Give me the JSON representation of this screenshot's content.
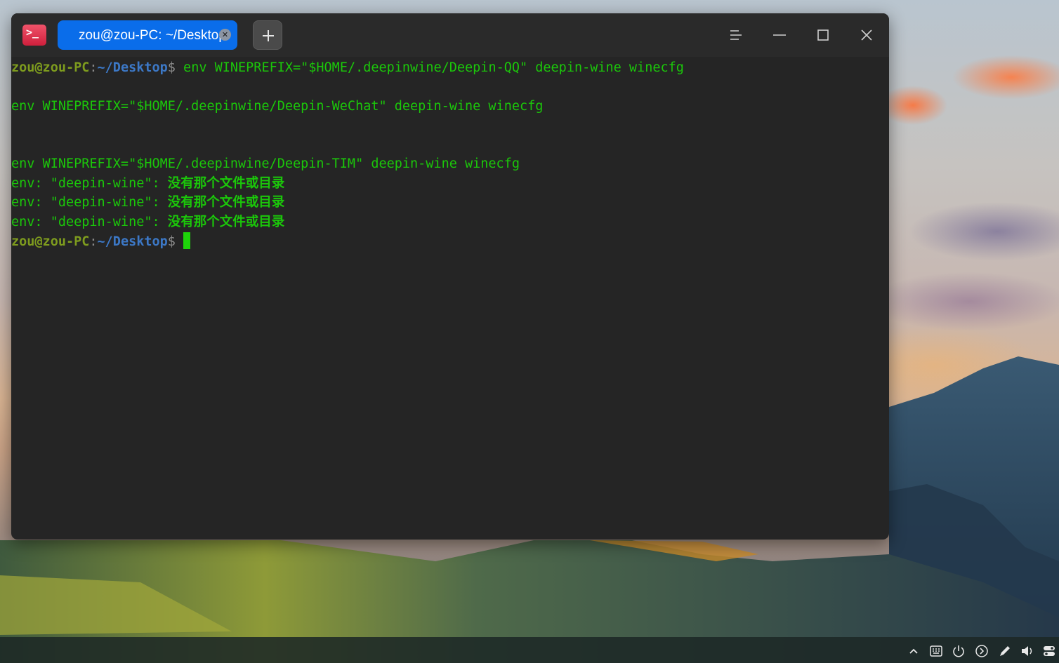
{
  "window": {
    "app_icon": "terminal-icon",
    "tab": {
      "label": "zou@zou-PC: ~/Desktop",
      "close_icon": "close-icon"
    },
    "new_tab_icon": "plus-icon",
    "controls": [
      "menu-icon",
      "minimize-icon",
      "maximize-icon",
      "close-icon"
    ]
  },
  "terminal": {
    "prompt": {
      "user_host": "zou@zou-PC",
      "colon": ":",
      "path": "~/Desktop",
      "dollar": "$"
    },
    "commands": [
      " env WINEPREFIX=\"$HOME/.deepinwine/Deepin-QQ\" deepin-wine winecfg",
      "env WINEPREFIX=\"$HOME/.deepinwine/Deepin-WeChat\" deepin-wine winecfg",
      "env WINEPREFIX=\"$HOME/.deepinwine/Deepin-TIM\" deepin-wine winecfg"
    ],
    "errors": [
      {
        "prefix": "env: \"deepin-wine\": ",
        "message": "没有那个文件或目录"
      },
      {
        "prefix": "env: \"deepin-wine\": ",
        "message": "没有那个文件或目录"
      },
      {
        "prefix": "env: \"deepin-wine\": ",
        "message": "没有那个文件或目录"
      }
    ],
    "colors": {
      "text": "#1bc70a",
      "user": "#7e9c1e",
      "path": "#3c78c6",
      "background": "#252525"
    }
  },
  "taskbar": {
    "tray": [
      "chevron-up-icon",
      "keyboard-icon",
      "power-icon",
      "arrow-circle-icon",
      "pen-icon",
      "volume-icon",
      "toggle-icon"
    ]
  },
  "colors": {
    "tab_active": "#0a6dea",
    "titlebar": "#2a2a2a"
  }
}
